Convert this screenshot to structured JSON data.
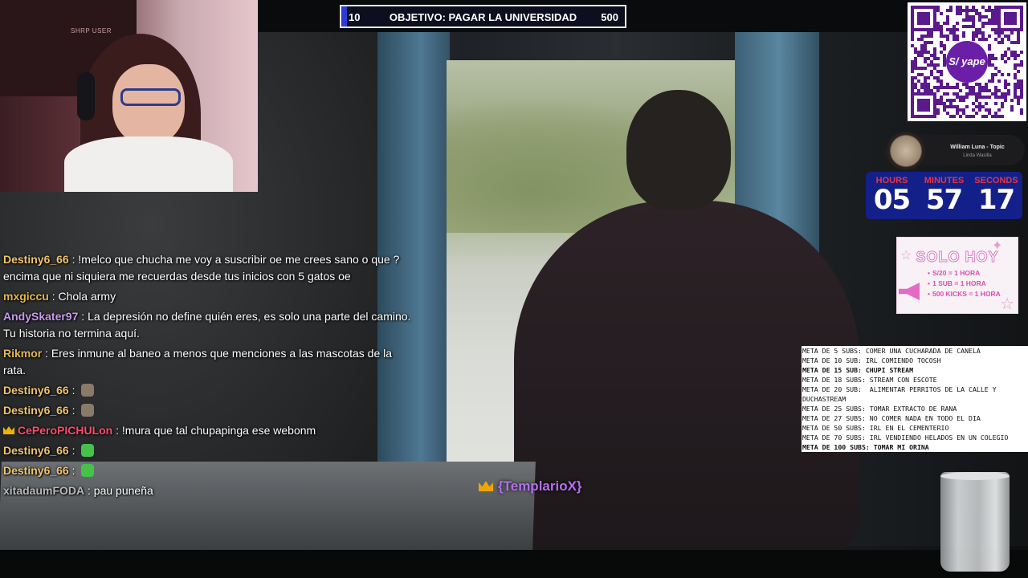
{
  "goal": {
    "current": "10",
    "title": "OBJETIVO: PAGAR LA UNIVERSIDAD",
    "target": "500",
    "progress_fraction": 0.02
  },
  "webcam": {
    "overlay_label": "SHRP USER"
  },
  "chat": [
    {
      "user": "Destiny6_66",
      "color": "#f2c56d",
      "text": "!melco que chucha me voy a suscribir oe me crees sano o que ? encima que ni siquiera me recuerdas desde tus inicios con 5 gatos oe"
    },
    {
      "user": "mxgiccu",
      "color": "#e3b84e",
      "text": "Chola army"
    },
    {
      "user": "AndySkater97",
      "color": "#c79bf0",
      "text": "La depresión no define quién eres, es solo una parte del camino. Tu historia no termina aquí."
    },
    {
      "user": "Rikmor",
      "color": "#e3b84e",
      "text": "Eres inmune al baneo a menos que menciones a las mascotas de la rata."
    },
    {
      "user": "Destiny6_66",
      "color": "#f2c56d",
      "text": "",
      "emote": "rat-emote",
      "emote_color": "#8a7a6a"
    },
    {
      "user": "Destiny6_66",
      "color": "#f2c56d",
      "text": "",
      "emote": "rat-emote",
      "emote_color": "#8a7a6a"
    },
    {
      "user": "CePeroPICHULon",
      "color": "#ff4d6d",
      "text": "!mura que tal chupapinga ese webonm",
      "badge": "crown-icon"
    },
    {
      "user": "Destiny6_66",
      "color": "#f2c56d",
      "text": "",
      "emote": "green-blob-emote",
      "emote_color": "#46c24a"
    },
    {
      "user": "Destiny6_66",
      "color": "#f2c56d",
      "text": "",
      "emote": "green-blob-emote",
      "emote_color": "#46c24a"
    },
    {
      "user": "xitadaumFODA",
      "color": "#b9b9b9",
      "text": "pau puneña"
    }
  ],
  "featured_user": {
    "name": "{TemplarioX}",
    "color": "#b26ff0"
  },
  "qr": {
    "brand": "yape",
    "currency": "S/"
  },
  "now_playing": {
    "artist": "William Luna - Topic",
    "song": "Linda Wasilla"
  },
  "countdown": {
    "hours_label": "HOURS",
    "minutes_label": "MINUTES",
    "seconds_label": "SECONDS",
    "hours": "05",
    "minutes": "57",
    "seconds": "17"
  },
  "promo": {
    "title": "SOLO HOY",
    "lines": [
      "S/20 = 1 HORA",
      "1 SUB = 1 HORA",
      "500 KICKS = 1 HORA"
    ]
  },
  "metas": [
    {
      "text": "META DE 5 SUBS: COMER UNA CUCHARADA DE CANELA",
      "bold": false
    },
    {
      "text": "META DE 10 SUB: IRL COMIENDO TOCOSH",
      "bold": false
    },
    {
      "text": "META DE 15 SUB: CHUPI STREAM",
      "bold": true
    },
    {
      "text": "META DE 18 SUBS: STREAM CON ESCOTE",
      "bold": false
    },
    {
      "text": "META DE 20 SUB:  ALIMENTAR PERRITOS DE LA CALLE Y DUCHASTREAM",
      "bold": false
    },
    {
      "text": "META DE 25 SUBS: TOMAR EXTRACTO DE RANA",
      "bold": false
    },
    {
      "text": "META DE 27 SUBS: NO COMER NADA EN TODO EL DIA",
      "bold": false
    },
    {
      "text": "META DE 50 SUBS: IRL EN EL CEMENTERIO",
      "bold": false
    },
    {
      "text": "META DE 70 SUBS: IRL VENDIENDO HELADOS EN UN COLEGIO",
      "bold": false
    },
    {
      "text": "META DE 100 SUBS: TOMAR MI ORINA",
      "bold": true
    }
  ]
}
